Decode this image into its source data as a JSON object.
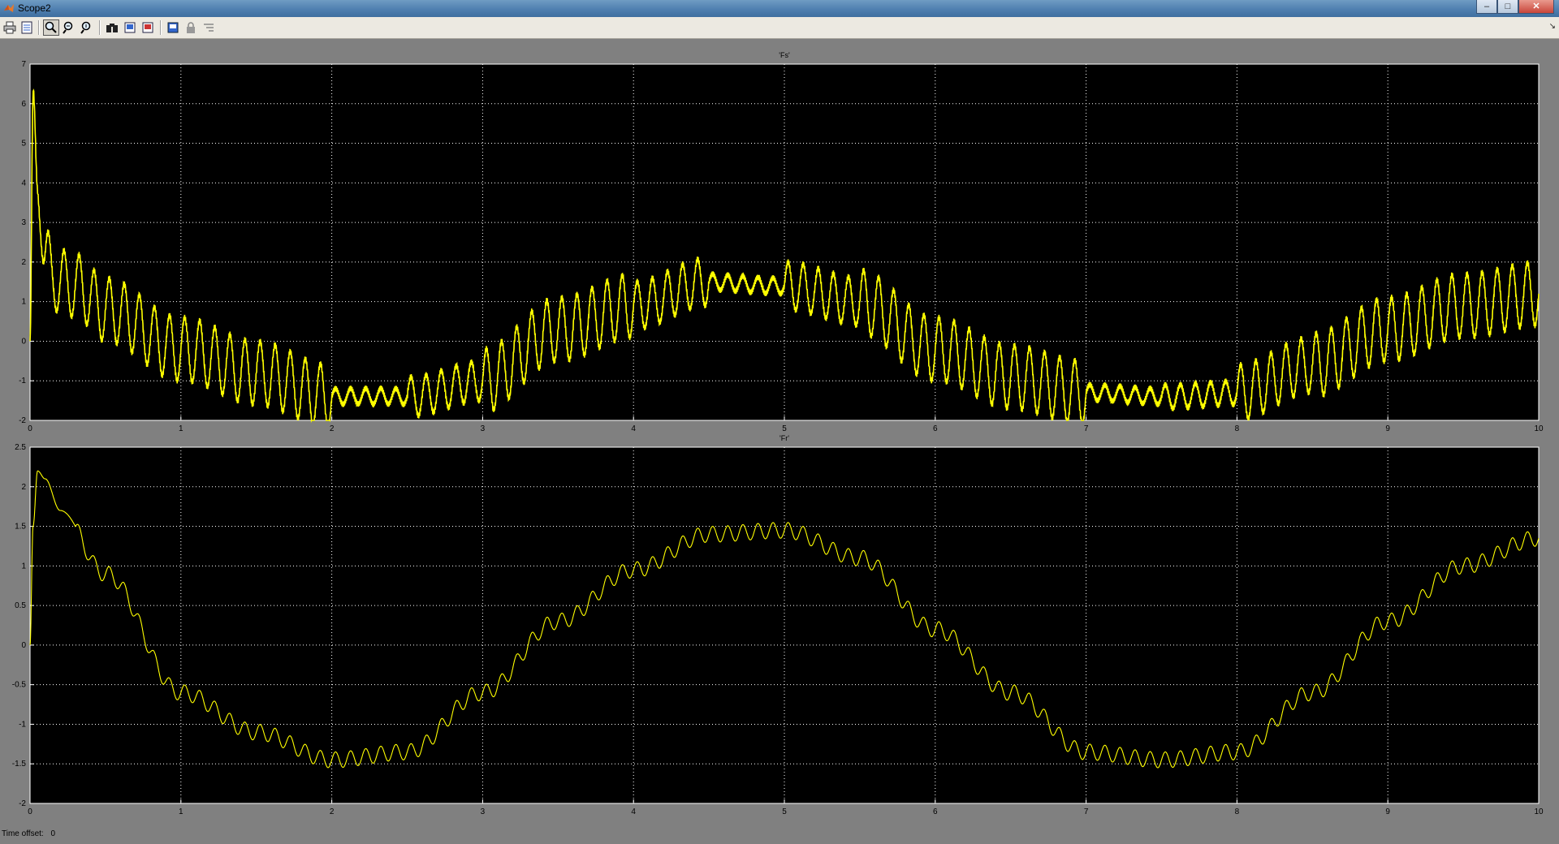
{
  "window": {
    "title": "Scope2",
    "controls": [
      "minimize-icon",
      "maximize-icon",
      "close-icon"
    ]
  },
  "toolbar": {
    "buttons": [
      {
        "name": "print-button",
        "icon": "printer-icon"
      },
      {
        "name": "parameters-button",
        "icon": "parameters-icon"
      },
      {
        "name": "zoom-button",
        "icon": "zoom-icon",
        "pressed": true
      },
      {
        "name": "zoom-x-button",
        "icon": "zoom-x-icon"
      },
      {
        "name": "zoom-y-button",
        "icon": "zoom-y-icon"
      },
      {
        "name": "autoscale-button",
        "icon": "binoculars-icon"
      },
      {
        "name": "save-axes-settings-button",
        "icon": "save-axes-icon"
      },
      {
        "name": "restore-axes-settings-button",
        "icon": "restore-axes-icon"
      },
      {
        "name": "floating-scope-button",
        "icon": "floating-scope-icon"
      },
      {
        "name": "lock-axes-button",
        "icon": "lock-icon"
      },
      {
        "name": "signal-selection-button",
        "icon": "signal-selection-icon"
      }
    ],
    "overflow_icon": "chevron-down-icon"
  },
  "footer": {
    "label": "Time offset:",
    "value": "0"
  },
  "colors": {
    "plot_background": "#000000",
    "trace": "#ffff00",
    "grid": "#ffffff",
    "figure_background": "#808080"
  },
  "chart_data": [
    {
      "type": "line",
      "title": "'Fs'",
      "xlim": [
        0,
        10
      ],
      "ylim": [
        -2,
        7
      ],
      "xticks": [
        0,
        1,
        2,
        3,
        4,
        5,
        6,
        7,
        8,
        9,
        10
      ],
      "yticks": [
        -2,
        -1,
        0,
        1,
        2,
        3,
        4,
        5,
        6,
        7
      ],
      "grid": true,
      "series": [
        {
          "x": [
            0,
            0.02,
            0.05,
            0.1,
            0.15,
            0.2,
            0.3,
            0.5,
            1.0,
            1.5,
            2.0,
            2.5,
            3.0,
            3.5,
            4.0,
            4.5,
            5.0,
            5.5,
            6.0,
            6.5,
            7.0,
            7.5,
            8.0,
            8.5,
            9.0,
            9.5,
            10.0
          ],
          "y": [
            0,
            6.1,
            3.8,
            2.2,
            1.6,
            1.5,
            1.4,
            0.8,
            -0.2,
            -0.8,
            -1.4,
            -1.4,
            -1.0,
            0.3,
            0.9,
            1.5,
            1.4,
            1.0,
            -0.2,
            -0.9,
            -1.3,
            -1.4,
            -1.3,
            -0.6,
            0.3,
            0.9,
            1.2
          ],
          "ripple_amplitude_envelope": [
            0,
            0.3,
            0.6,
            0.8,
            0.8,
            0.8,
            0.8,
            0.8,
            0.8,
            0.8,
            0.2,
            0.5,
            0.8,
            0.8,
            0.6,
            0.2,
            0.6,
            0.8,
            0.8,
            0.8,
            0.2,
            0.3,
            0.7,
            0.8,
            0.8,
            0.8
          ]
        }
      ]
    },
    {
      "type": "line",
      "title": "'Fr'",
      "xlim": [
        0,
        10
      ],
      "ylim": [
        -2,
        2.5
      ],
      "xticks": [
        0,
        1,
        2,
        3,
        4,
        5,
        6,
        7,
        8,
        9,
        10
      ],
      "yticks": [
        -2,
        -1.5,
        -1,
        -0.5,
        0,
        0.5,
        1,
        1.5,
        2,
        2.5
      ],
      "grid": true,
      "series": [
        {
          "x": [
            0,
            0.02,
            0.05,
            0.1,
            0.2,
            0.5,
            1.0,
            1.5,
            2.0,
            2.5,
            3.0,
            3.5,
            4.0,
            4.5,
            5.0,
            5.5,
            6.0,
            6.5,
            7.0,
            7.5,
            8.0,
            8.5,
            9.0,
            9.5,
            10.0
          ],
          "y": [
            0,
            1.5,
            2.2,
            2.1,
            1.7,
            0.9,
            -0.6,
            -1.1,
            -1.45,
            -1.35,
            -0.6,
            0.3,
            0.95,
            1.4,
            1.45,
            1.1,
            0.2,
            -0.6,
            -1.35,
            -1.45,
            -1.35,
            -0.6,
            0.3,
            1.0,
            1.35
          ]
        }
      ]
    }
  ]
}
